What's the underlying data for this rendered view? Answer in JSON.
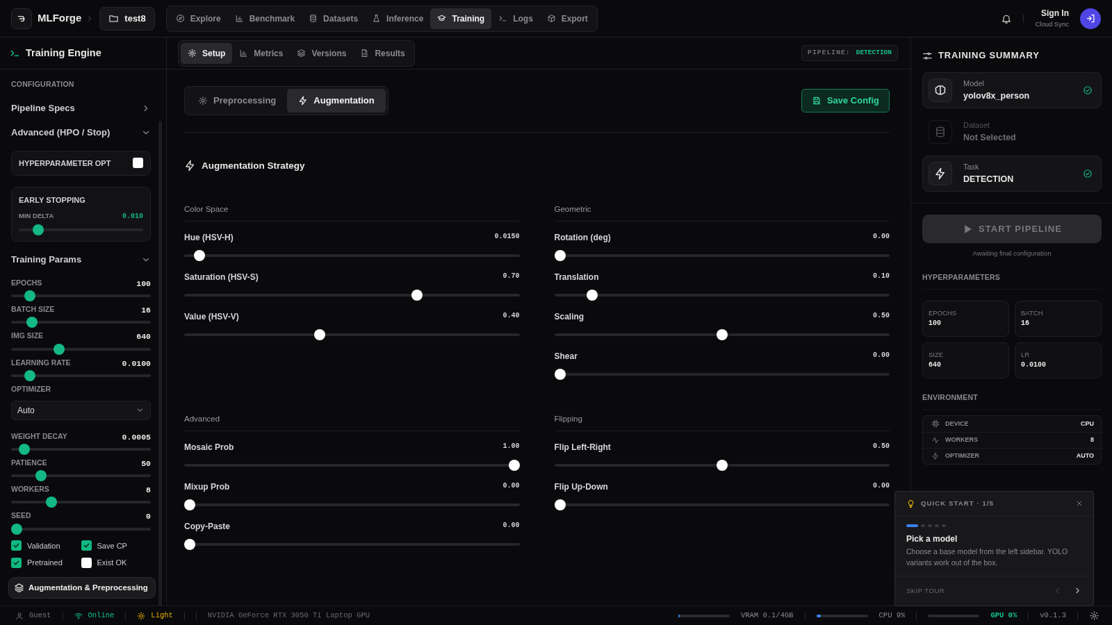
{
  "app": {
    "name": "MLForge",
    "project": "test8"
  },
  "nav_tabs": [
    {
      "label": "Explore",
      "selected": false
    },
    {
      "label": "Benchmark",
      "selected": false
    },
    {
      "label": "Datasets",
      "selected": false
    },
    {
      "label": "Inference",
      "selected": false
    },
    {
      "label": "Training",
      "selected": true
    },
    {
      "label": "Logs",
      "selected": false
    },
    {
      "label": "Export",
      "selected": false
    }
  ],
  "account": {
    "label": "Sign In",
    "sublabel": "Cloud Sync"
  },
  "sidebar": {
    "title": "Training Engine",
    "section_label": "CONFIGURATION",
    "pipeline_specs": {
      "label": "Pipeline Specs",
      "expanded": false
    },
    "advanced": {
      "label": "Advanced (HPO / Stop)",
      "expanded": true,
      "hpo": {
        "label": "HYPERPARAMETER OPT",
        "checked": false
      },
      "early_stopping": {
        "title": "EARLY STOPPING",
        "label": "MIN DELTA",
        "value": "0.010",
        "level": 0.12
      }
    },
    "training_params": {
      "label": "Training Params",
      "expanded": true,
      "sliders": [
        {
          "label": "EPOCHS",
          "value": "100",
          "level": 0.1
        },
        {
          "label": "BATCH SIZE",
          "value": "16",
          "level": 0.12
        },
        {
          "label": "IMG SIZE",
          "value": "640",
          "level": 0.33
        },
        {
          "label": "LEARNING RATE",
          "value": "0.0100",
          "level": 0.1
        }
      ],
      "optimizer": {
        "label": "OPTIMIZER",
        "value": "Auto"
      },
      "sliders_after": [
        {
          "label": "WEIGHT DECAY",
          "value": "0.0005",
          "level": 0.06
        },
        {
          "label": "PATIENCE",
          "value": "50",
          "level": 0.19
        },
        {
          "label": "WORKERS",
          "value": "8",
          "level": 0.27
        },
        {
          "label": "SEED",
          "value": "0",
          "level": 0
        }
      ],
      "checkboxes": [
        {
          "label": "Validation",
          "checked": true
        },
        {
          "label": "Save CP",
          "checked": true
        },
        {
          "label": "Pretrained",
          "checked": true
        },
        {
          "label": "Exist OK",
          "checked": false
        }
      ]
    },
    "footer_button": "Augmentation & Preprocessing"
  },
  "main": {
    "sub_tabs": [
      {
        "label": "Setup",
        "selected": true
      },
      {
        "label": "Metrics",
        "selected": false
      },
      {
        "label": "Versions",
        "selected": false
      },
      {
        "label": "Results",
        "selected": false
      }
    ],
    "pipeline": {
      "label": "PIPELINE:",
      "value": "DETECTION"
    },
    "mode_tabs": [
      {
        "label": "Preprocessing",
        "selected": false
      },
      {
        "label": "Augmentation",
        "selected": true
      }
    ],
    "save_button": "Save Config",
    "section_title": "Augmentation Strategy",
    "groups": [
      {
        "title": "Color Space",
        "sliders": [
          {
            "label": "Hue (HSV-H)",
            "value": "0.0150",
            "level": 0.03
          },
          {
            "label": "Saturation (HSV-S)",
            "value": "0.70",
            "level": 0.7
          },
          {
            "label": "Value (HSV-V)",
            "value": "0.40",
            "level": 0.4
          }
        ]
      },
      {
        "title": "Geometric",
        "sliders": [
          {
            "label": "Rotation (deg)",
            "value": "0.00",
            "level": 0
          },
          {
            "label": "Translation",
            "value": "0.10",
            "level": 0.1
          },
          {
            "label": "Scaling",
            "value": "0.50",
            "level": 0.5
          },
          {
            "label": "Shear",
            "value": "0.00",
            "level": 0
          }
        ]
      },
      {
        "title": "Advanced",
        "sliders": [
          {
            "label": "Mosaic Prob",
            "value": "1.00",
            "level": 1
          },
          {
            "label": "Mixup Prob",
            "value": "0.00",
            "level": 0
          },
          {
            "label": "Copy-Paste",
            "value": "0.00",
            "level": 0
          }
        ]
      },
      {
        "title": "Flipping",
        "sliders": [
          {
            "label": "Flip Left-Right",
            "value": "0.50",
            "level": 0.5
          },
          {
            "label": "Flip Up-Down",
            "value": "0.00",
            "level": 0
          }
        ]
      }
    ]
  },
  "summary": {
    "title": "TRAINING SUMMARY",
    "items": [
      {
        "label": "Model",
        "value": "yolov8x_person",
        "complete": true
      },
      {
        "label": "Dataset",
        "value": "Not Selected",
        "complete": false
      },
      {
        "label": "Task",
        "value": "DETECTION",
        "complete": true
      }
    ],
    "start_button": {
      "label": "START PIPELINE",
      "disabled": true
    },
    "hint": "Awaiting final configuration",
    "hyper_title": "HYPERPARAMETERS",
    "hyper": [
      {
        "label": "EPOCHS",
        "value": "100"
      },
      {
        "label": "BATCH",
        "value": "16"
      },
      {
        "label": "SIZE",
        "value": "640"
      },
      {
        "label": "LR",
        "value": "0.0100"
      }
    ],
    "env_title": "ENVIRONMENT",
    "env": [
      {
        "label": "DEVICE",
        "value": "CPU"
      },
      {
        "label": "WORKERS",
        "value": "8"
      },
      {
        "label": "OPTIMIZER",
        "value": "AUTO"
      }
    ]
  },
  "quick_start": {
    "title": "QUICK START · 1/5",
    "steps": [
      {
        "selected": true
      },
      {
        "selected": false
      },
      {
        "selected": false
      },
      {
        "selected": false
      },
      {
        "selected": false
      }
    ],
    "heading": "Pick a model",
    "body": "Choose a base model from the left sidebar. YOLO variants work out of the box.",
    "skip": "SKIP TOUR",
    "prev_disabled": true
  },
  "status_bar": {
    "user": "Guest",
    "connection": "Online",
    "theme": "Light",
    "gpu_name": "NVIDIA GeForce RTX 3050 Ti Laptop GPU",
    "meters": [
      {
        "label": "VRAM 0.1/4GB",
        "level": 0.03,
        "active": false
      },
      {
        "label": "CPU 9%",
        "level": 0.09,
        "active": false
      },
      {
        "label": "GPU 0%",
        "level": 0,
        "active": true
      }
    ],
    "version": "v0.1.3"
  }
}
